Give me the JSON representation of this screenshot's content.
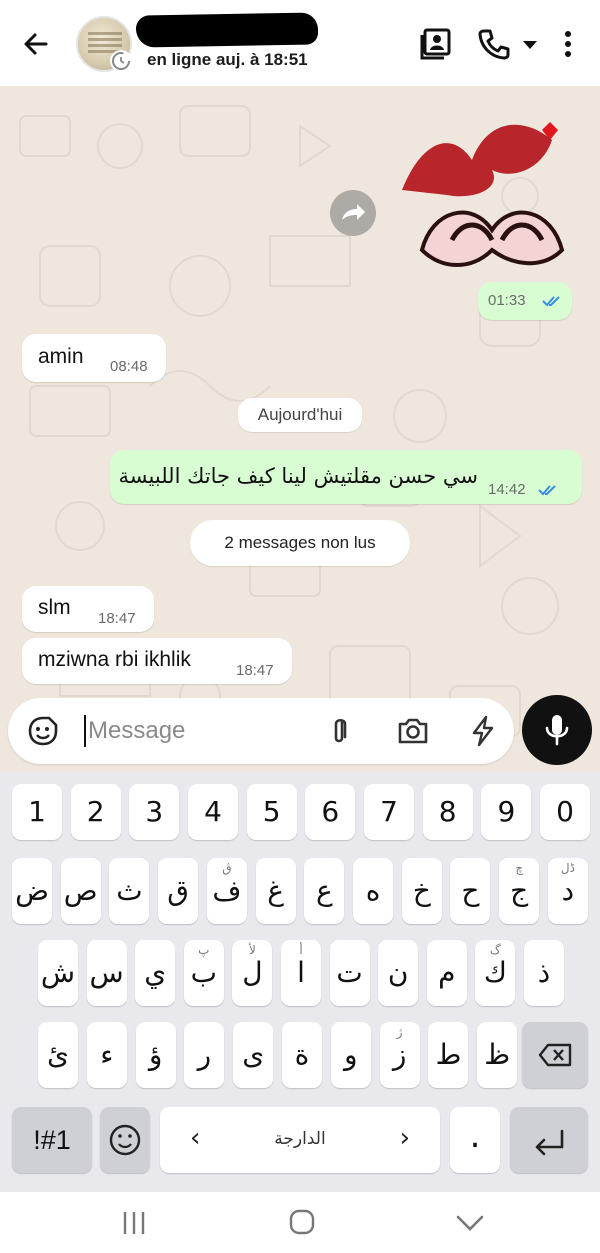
{
  "header": {
    "status_text": "en ligne auj. à 18:51",
    "icons": [
      "back-arrow-icon",
      "avatar",
      "contact-card-icon",
      "phone-icon",
      "chevron-down-icon",
      "more-vert-icon"
    ]
  },
  "chat": {
    "outgoing_sticker": {
      "time": "01:33"
    },
    "messages": [
      {
        "dir": "in",
        "text": "amin",
        "time": "08:48"
      },
      {
        "dir": "out",
        "text": "سي حسن مقلتيش لينا كيف جاتك اللبيسة",
        "time": "14:42"
      },
      {
        "dir": "in",
        "text": "slm",
        "time": "18:47"
      },
      {
        "dir": "in",
        "text": "mziwna rbi ikhlik",
        "time": "18:47"
      }
    ],
    "date_pill": "Aujourd'hui",
    "unread_pill": "2 messages non lus"
  },
  "input": {
    "placeholder": "Message"
  },
  "keyboard": {
    "rows": [
      [
        {
          "l": "1"
        },
        {
          "l": "2"
        },
        {
          "l": "3"
        },
        {
          "l": "4"
        },
        {
          "l": "5"
        },
        {
          "l": "6"
        },
        {
          "l": "7"
        },
        {
          "l": "8"
        },
        {
          "l": "9"
        },
        {
          "l": "0"
        }
      ],
      [
        {
          "l": "ض"
        },
        {
          "l": "ص"
        },
        {
          "l": "ث"
        },
        {
          "l": "ق"
        },
        {
          "l": "ف",
          "h": "ڨ"
        },
        {
          "l": "غ"
        },
        {
          "l": "ع"
        },
        {
          "l": "ه"
        },
        {
          "l": "خ"
        },
        {
          "l": "ح"
        },
        {
          "l": "ج",
          "h": "چ"
        },
        {
          "l": "د",
          "h": "ڈل"
        }
      ],
      [
        {
          "l": "ش"
        },
        {
          "l": "س"
        },
        {
          "l": "ي"
        },
        {
          "l": "ب",
          "h": "پ"
        },
        {
          "l": "ل",
          "h": "لأ"
        },
        {
          "l": "ا",
          "h": "أ"
        },
        {
          "l": "ت"
        },
        {
          "l": "ن"
        },
        {
          "l": "م"
        },
        {
          "l": "ك",
          "h": "گ"
        },
        {
          "l": "ذ"
        }
      ],
      [
        {
          "l": "ئ"
        },
        {
          "l": "ء"
        },
        {
          "l": "ؤ"
        },
        {
          "l": "ر"
        },
        {
          "l": "ى"
        },
        {
          "l": "ة"
        },
        {
          "l": "و"
        },
        {
          "l": "ز",
          "h": "ژ"
        },
        {
          "l": "ط"
        },
        {
          "l": "ظ"
        }
      ]
    ],
    "symbols_key": "!#1",
    "language_label": "الدارجة",
    "period_key": ".",
    "prev_arrow": "‹",
    "next_arrow": "›"
  }
}
